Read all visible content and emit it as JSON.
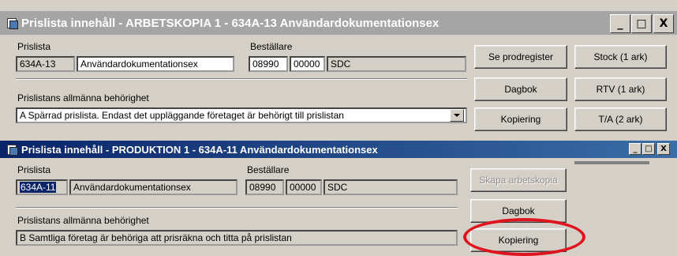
{
  "window1": {
    "title": "Prislista innehåll - ARBETSKOPIA 1 - 634A-13 Användardokumentationsex",
    "controls": {
      "minimize": "_",
      "maximize": "□",
      "close": "X"
    },
    "prislista_label": "Prislista",
    "prislista_code": "634A-13",
    "prislista_name": "Användardokumentationsex",
    "bestallare_label": "Beställare",
    "bestallare_1": "08990",
    "bestallare_2": "00000",
    "bestallare_3": "SDC",
    "behorighet_label": "Prislistans allmänna behörighet",
    "behorighet_value": "A Spärrad prislista. Endast det uppläggande företaget är behörigt till prislistan",
    "buttons": {
      "se_prodregister": "Se prodregister",
      "stock": "Stock (1 ark)",
      "dagbok": "Dagbok",
      "rtv": "RTV (1 ark)",
      "kopiering": "Kopiering",
      "ta": "T/A (2 ark)"
    }
  },
  "window2": {
    "title": "Prislista innehåll - PRODUKTION 1 - 634A-11 Användardokumentationsex",
    "controls": {
      "minimize": "_",
      "maximize": "□",
      "close": "X"
    },
    "prislista_label": "Prislista",
    "prislista_code": "634A-11",
    "prislista_name": "Användardokumentationsex",
    "bestallare_label": "Beställare",
    "bestallare_1": "08990",
    "bestallare_2": "00000",
    "bestallare_3": "SDC",
    "behorighet_label": "Prislistans allmänna behörighet",
    "behorighet_value": "B Samtliga företag är behöriga att prisräkna och titta på prislistan",
    "buttons": {
      "skapa_arbetskopia": "Skapa arbetskopia",
      "dagbok": "Dagbok",
      "kopiering": "Kopiering"
    }
  },
  "annotation_color": "#e0141e"
}
